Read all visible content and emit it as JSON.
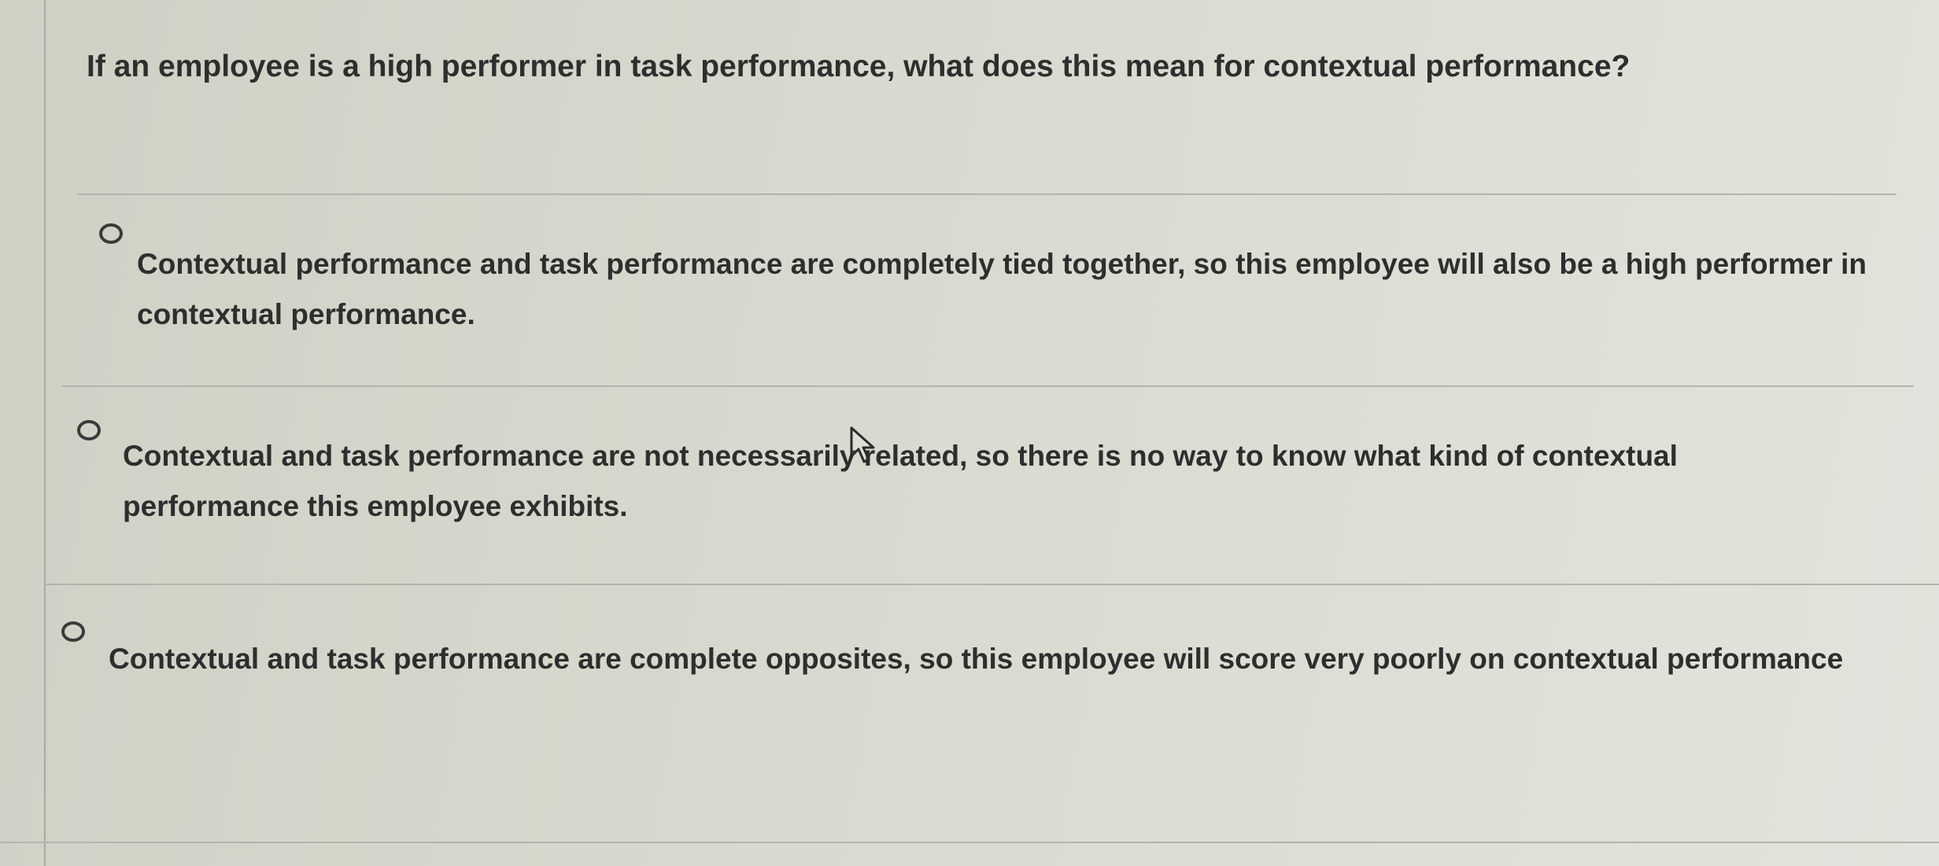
{
  "question": {
    "text": "If an employee is a high performer in task performance, what does this mean for contextual performance?"
  },
  "options": [
    {
      "label": "Contextual performance and task performance are completely tied together, so this employee will also be a high performer in contextual performance.",
      "selected": false
    },
    {
      "label": "Contextual and task performance are not necessarily related, so there is no way to know what kind of contextual performance this employee exhibits.",
      "selected": false
    },
    {
      "label": "Contextual and task performance are complete opposites, so this employee will score very poorly on contextual performance",
      "selected": false
    }
  ],
  "colors": {
    "background": "#d6d8cd",
    "text": "#2e2e2e",
    "divider": "#b3b4ab"
  },
  "icons": {
    "cursor": "mouse-pointer-icon",
    "radio": "radio-button-icon"
  }
}
